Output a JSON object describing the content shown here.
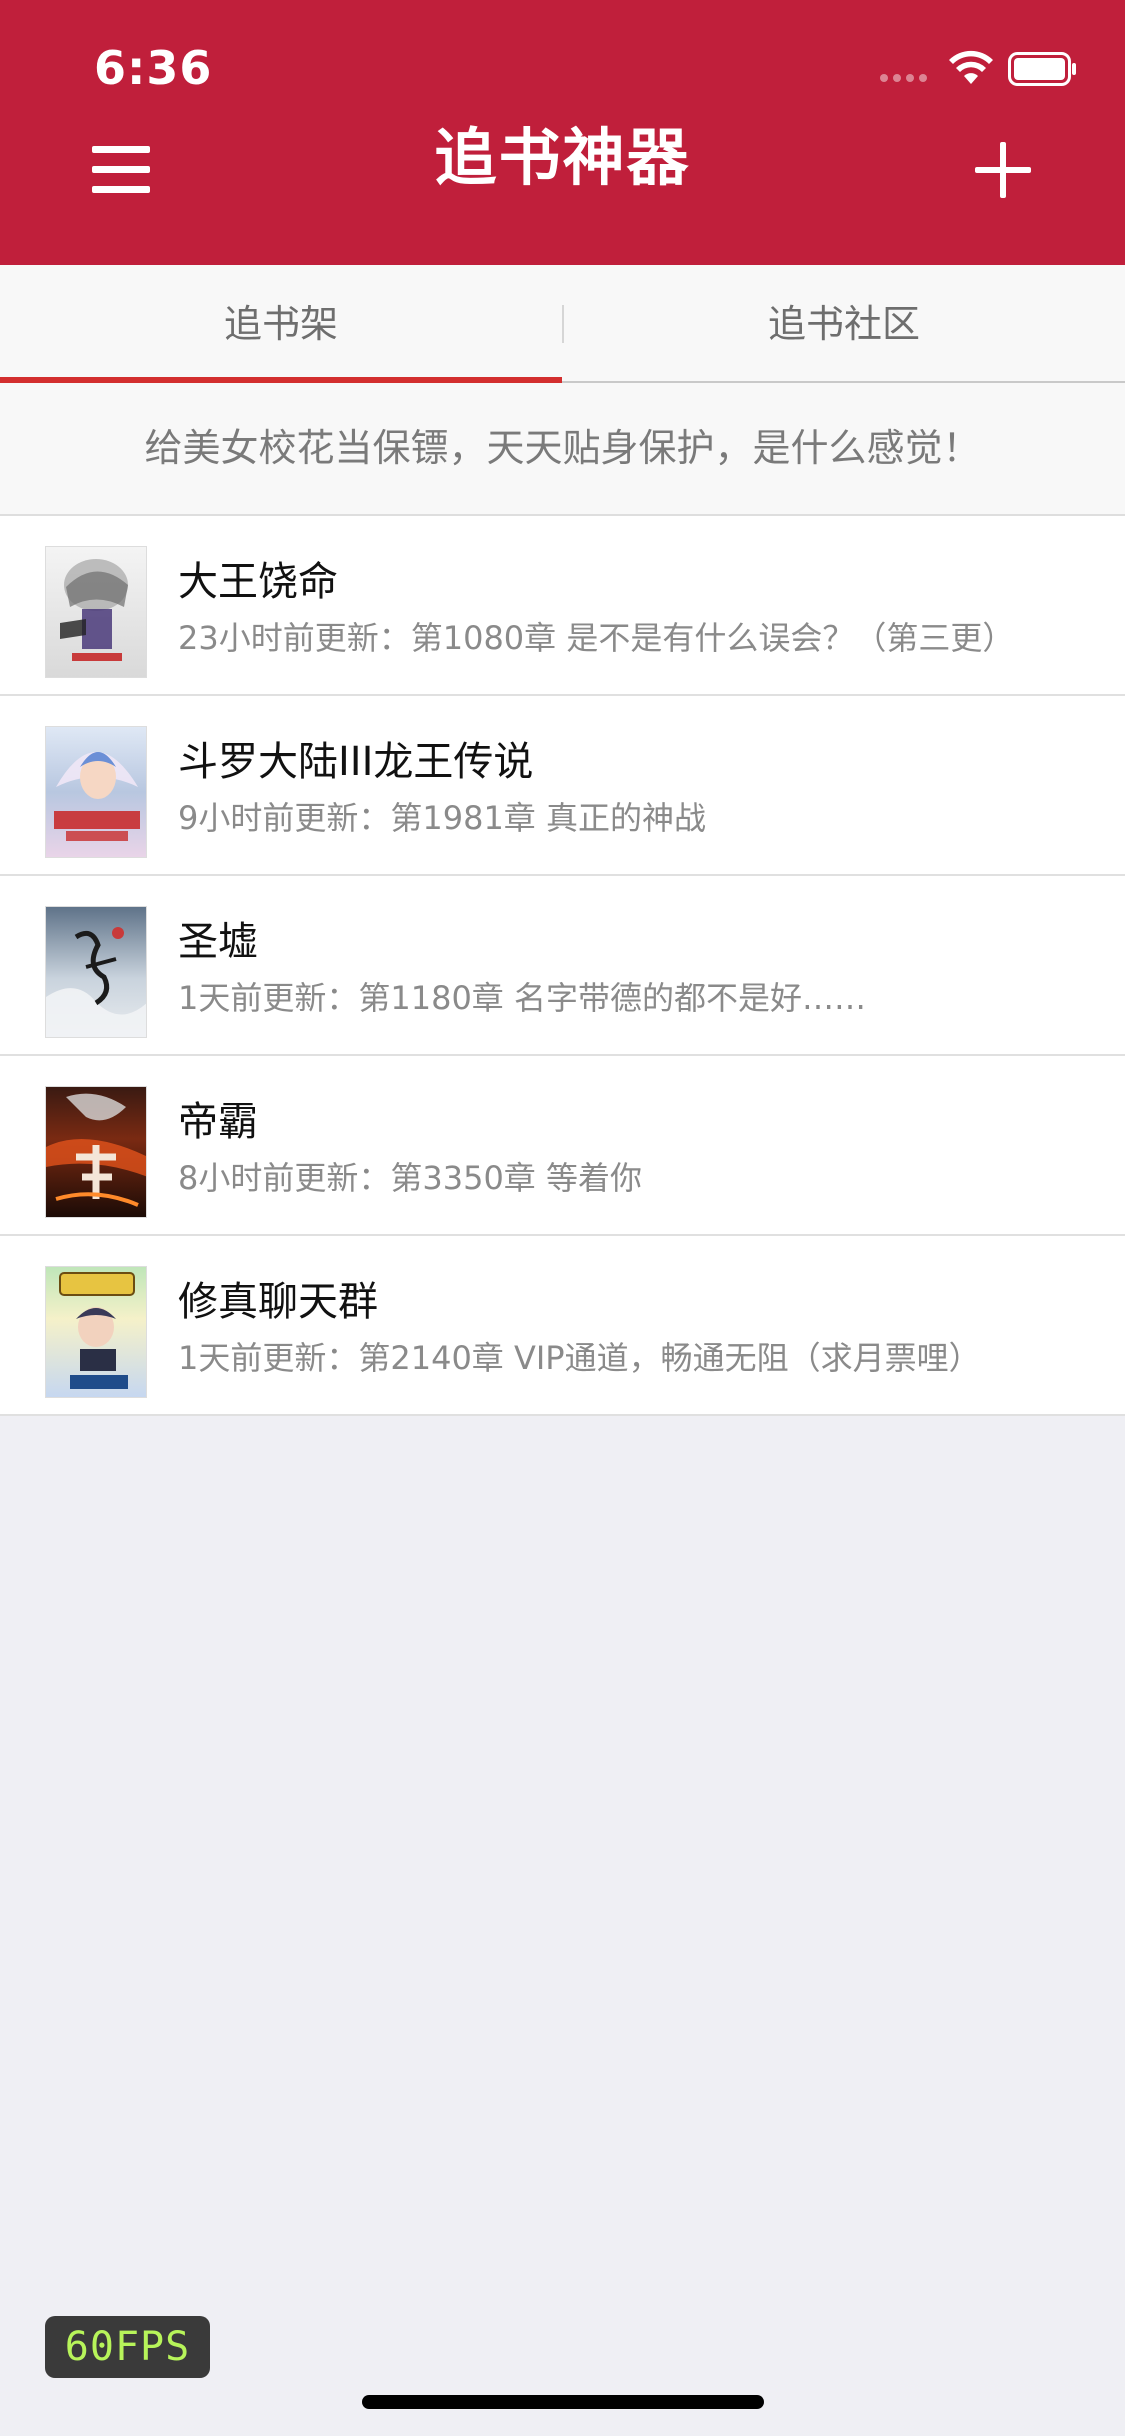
{
  "status_bar": {
    "time": "6:36"
  },
  "header": {
    "title": "追书神器",
    "menu_icon": "hamburger-menu-icon",
    "add_icon": "plus-icon",
    "background": "#c01f3b"
  },
  "tabs": [
    {
      "label": "追书架",
      "active": true
    },
    {
      "label": "追书社区",
      "active": false
    }
  ],
  "banner": {
    "text": "给美女校花当保镖，天天贴身保护，是什么感觉！"
  },
  "books": [
    {
      "title": "大王饶命",
      "update": "23小时前更新：第1080章 是不是有什么误会？（第三更）"
    },
    {
      "title": "斗罗大陆III龙王传说",
      "update": "9小时前更新：第1981章 真正的神战"
    },
    {
      "title": "圣墟",
      "update": "1天前更新：第1180章 名字带德的都不是好……"
    },
    {
      "title": "帝霸",
      "update": "8小时前更新：第3350章 等着你"
    },
    {
      "title": "修真聊天群",
      "update": "1天前更新：第2140章 VIP通道，畅通无阻（求月票哩）"
    }
  ],
  "fps_badge": {
    "text": "60FPS"
  },
  "colors": {
    "accent": "#c01f3b",
    "tab_underline": "#d32f2f",
    "fps_text": "#b7f45a"
  }
}
